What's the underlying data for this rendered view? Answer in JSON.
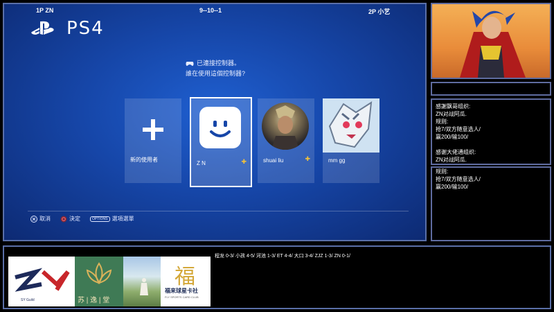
{
  "hud": {
    "p1": "1P ZN",
    "center": "9--10--1",
    "p2": "2P 小艺"
  },
  "ps4": {
    "logo_text": "PS4",
    "prompt_line1": "已連接控制器。",
    "prompt_line2": "誰在使用這個控制器?",
    "users": [
      {
        "name": "新的使用者",
        "type": "new",
        "plus": false
      },
      {
        "name": "Z N",
        "type": "smiley",
        "plus": true,
        "selected": true
      },
      {
        "name": "shuai liu",
        "type": "warrior",
        "plus": true
      },
      {
        "name": "mm gg",
        "type": "creature",
        "plus": false
      }
    ],
    "hints": [
      {
        "icon": "cross-button-icon",
        "label": "取消"
      },
      {
        "icon": "circle-button-icon",
        "label": "決定"
      },
      {
        "icon": "options-button-icon",
        "key": "OPTIONS",
        "label": "選項選單"
      }
    ]
  },
  "notes": [
    {
      "lines": [
        "感謝飘哥组织:",
        "ZN对战阿瓜.",
        "规则:",
        "抢7/双方随意选人/",
        "赢200/输100/",
        "",
        "感谢大佬通组织:",
        "ZN对战阿瓜.",
        "规则:",
        "抢7/双方随意选人/",
        "赢200/输100/"
      ]
    }
  ],
  "banner": {
    "scoreline": "程龙 0-3/ 小孩 4-5/ 河池 1-3/ ET 4-4/ 大口 3-4/ ZJZ 1-3/ ZN 0-1/",
    "logos": [
      {
        "text": "SYG",
        "sub": "SY Guild"
      },
      {
        "text": "苏 | 逸 | 堂"
      },
      {
        "text": ""
      },
      {
        "text": "福来球星卡社",
        "glyph": "福",
        "sub": "FLY SPORTS CARD CLUB"
      }
    ]
  },
  "colors": {
    "ps4_blue": "#1646a8",
    "border": "#5a6fa8",
    "plus_gold": "#f2c23a"
  }
}
